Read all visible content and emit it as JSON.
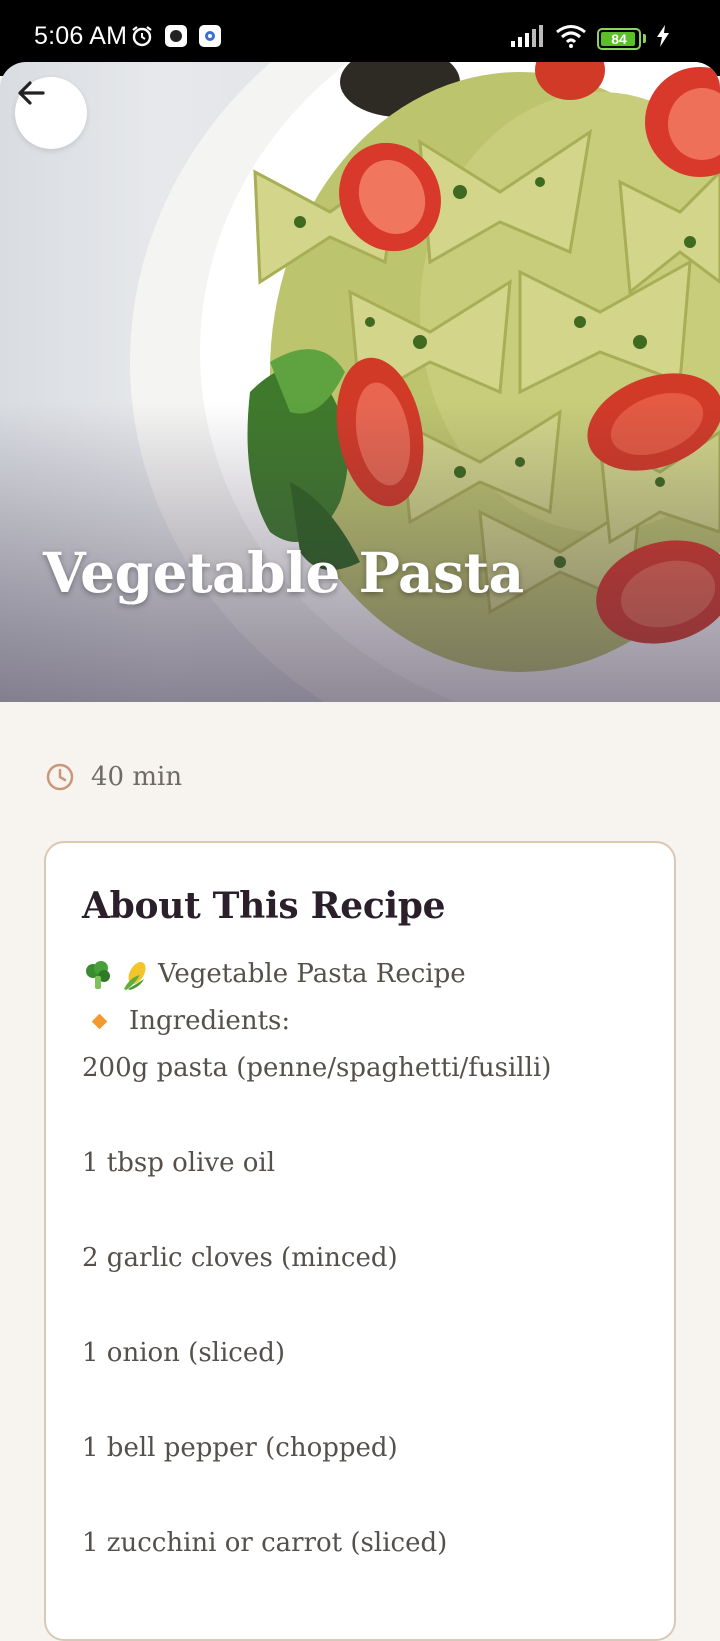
{
  "status_bar": {
    "time": "5:06 AM",
    "battery_level": "84",
    "icons": [
      "alarm-icon",
      "app-icon",
      "settings-gear-icon",
      "signal-icon",
      "wifi-icon",
      "battery-icon",
      "charging-bolt-icon"
    ]
  },
  "hero": {
    "title": "Vegetable Pasta",
    "back_icon": "arrow-left-icon"
  },
  "meta": {
    "time_icon": "clock-icon",
    "duration": "40 min"
  },
  "about": {
    "heading": "About This Recipe",
    "header_line": "Vegetable Pasta Recipe",
    "header_emojis": [
      "broccoli-emoji",
      "corn-emoji"
    ],
    "ingredients_label": "Ingredients:",
    "ingredients": [
      "200g pasta (penne/spaghetti/fusilli)",
      "1 tbsp olive oil",
      "2 garlic cloves (minced)",
      "1 onion (sliced)",
      "1 bell pepper (chopped)",
      "1 zucchini or carrot (sliced)"
    ]
  },
  "colors": {
    "background": "#f7f4ef",
    "card_border": "#d9c8b6",
    "heading": "#2a1f2b",
    "body_text": "#55504c",
    "accent_orange": "#f29a2e",
    "clock_icon": "#c9967a"
  }
}
